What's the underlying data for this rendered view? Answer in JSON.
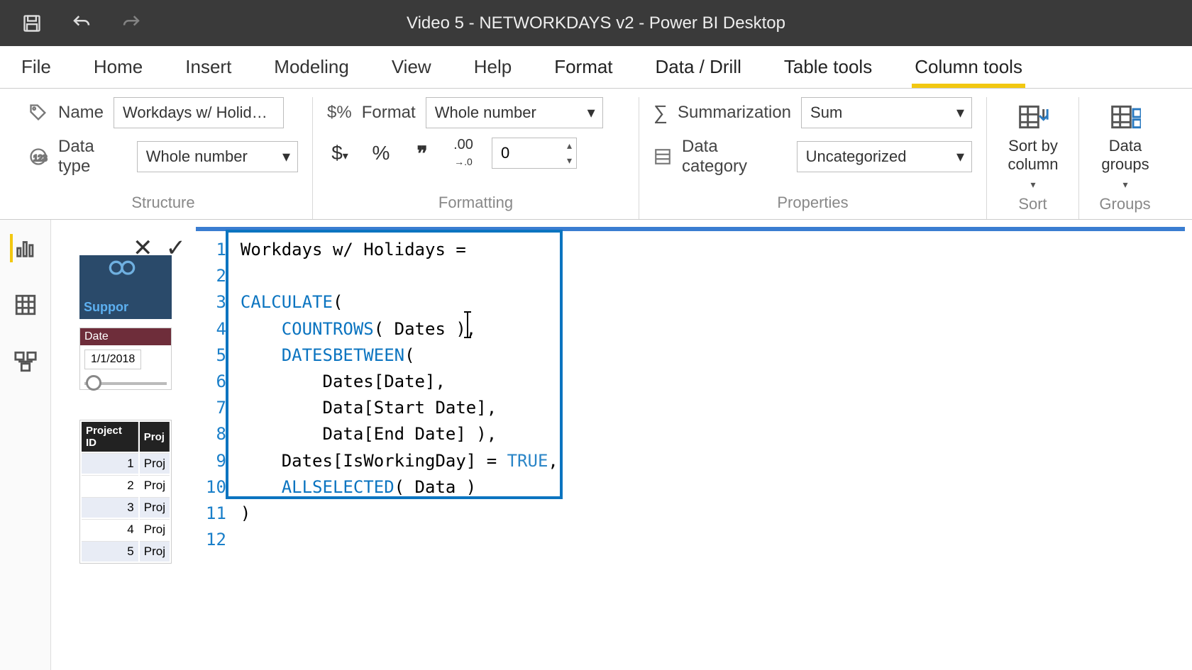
{
  "app": {
    "title": "Video 5 - NETWORKDAYS v2 - Power BI Desktop"
  },
  "menu": {
    "file": "File",
    "home": "Home",
    "insert": "Insert",
    "modeling": "Modeling",
    "view": "View",
    "help": "Help",
    "format": "Format",
    "data_drill": "Data / Drill",
    "table_tools": "Table tools",
    "column_tools": "Column tools"
  },
  "ribbon": {
    "structure": {
      "label": "Structure",
      "name_label": "Name",
      "name_value": "Workdays w/ Holid…",
      "data_type_label": "Data type",
      "data_type_value": "Whole number"
    },
    "formatting": {
      "label": "Formatting",
      "format_label": "Format",
      "format_value": "Whole number",
      "decimal_places": "0"
    },
    "properties": {
      "label": "Properties",
      "summarization_label": "Summarization",
      "summarization_value": "Sum",
      "data_category_label": "Data category",
      "data_category_value": "Uncategorized"
    },
    "sort": {
      "label": "Sort",
      "sort_by_column": "Sort by\ncolumn"
    },
    "groups": {
      "label": "Groups",
      "data_groups": "Data\ngroups"
    }
  },
  "formula": {
    "lines": [
      "Workdays w/ Holidays =",
      "",
      "CALCULATE(",
      "    COUNTROWS( Dates ),",
      "    DATESBETWEEN(",
      "        Dates[Date],",
      "        Data[Start Date],",
      "        Data[End Date] ),",
      "    Dates[IsWorkingDay] = TRUE,",
      "    ALLSELECTED( Data )",
      ")",
      ""
    ],
    "line_numbers": [
      "1",
      "2",
      "3",
      "4",
      "5",
      "6",
      "7",
      "8",
      "9",
      "10",
      "11",
      "12"
    ]
  },
  "canvas": {
    "support_label": "Suppor",
    "slicer_header": "Date",
    "slicer_value": "1/1/2018",
    "table_headers": [
      "Project ID",
      "Proj"
    ],
    "table_rows": [
      [
        "1",
        "Proj"
      ],
      [
        "2",
        "Proj"
      ],
      [
        "3",
        "Proj"
      ],
      [
        "4",
        "Proj"
      ],
      [
        "5",
        "Proj"
      ]
    ]
  }
}
